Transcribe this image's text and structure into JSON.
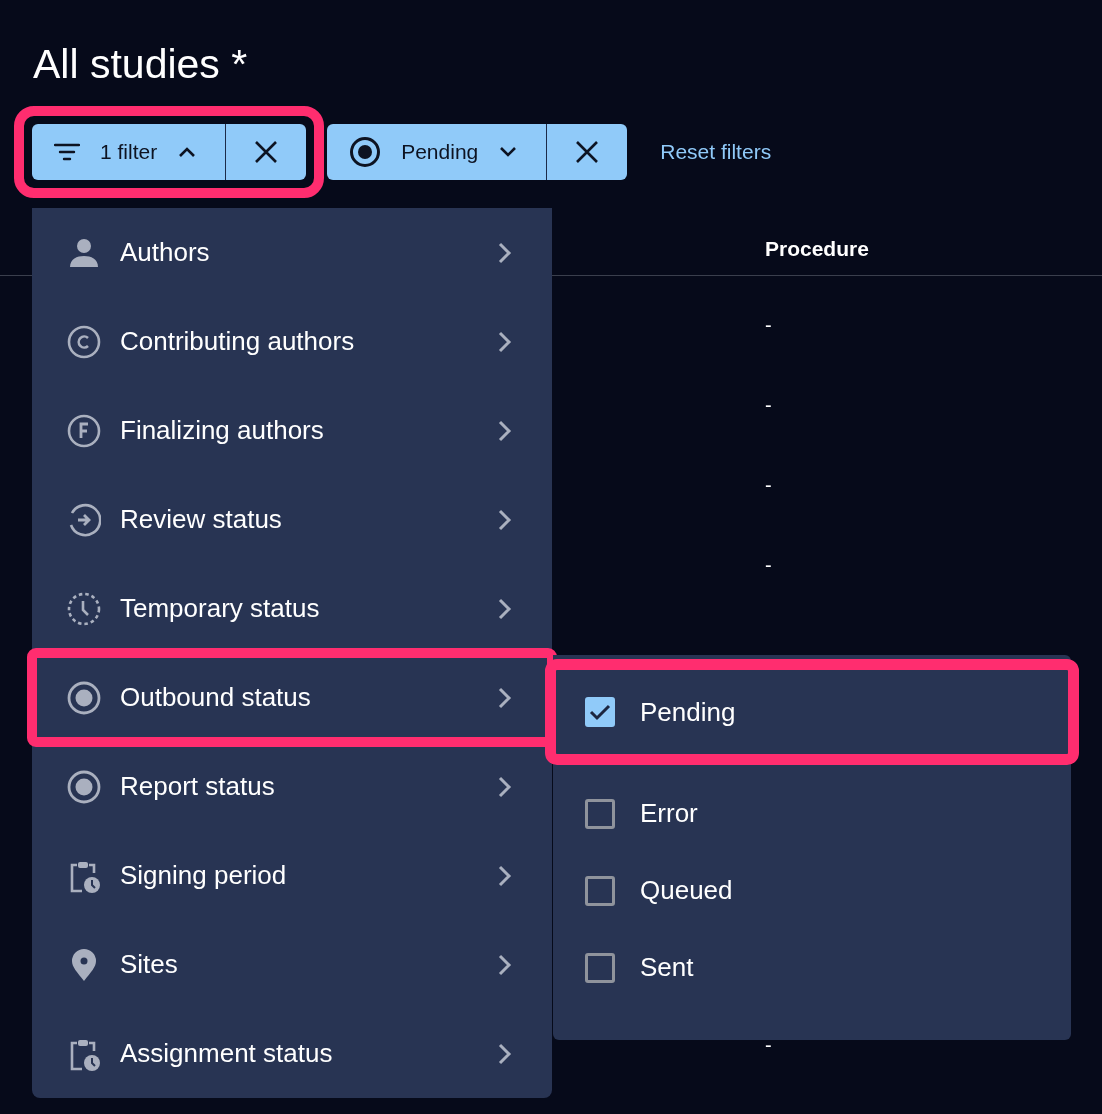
{
  "page": {
    "title": "All studies *"
  },
  "filter_bar": {
    "filter_button": {
      "label": "1 filter",
      "expanded": true,
      "highlighted": true
    },
    "chips": [
      {
        "label": "Pending",
        "expanded": false
      }
    ],
    "reset_link": "Reset filters"
  },
  "table": {
    "columns": [
      "Procedure"
    ],
    "rows": [
      {
        "procedure": "-"
      },
      {
        "procedure": "-"
      },
      {
        "procedure": "-"
      },
      {
        "procedure": "-"
      },
      {
        "procedure": "-"
      }
    ]
  },
  "filter_menu": {
    "items": [
      {
        "label": "Authors",
        "highlighted": false
      },
      {
        "label": "Contributing authors",
        "highlighted": false
      },
      {
        "label": "Finalizing authors",
        "highlighted": false
      },
      {
        "label": "Review status",
        "highlighted": false
      },
      {
        "label": "Temporary status",
        "highlighted": false
      },
      {
        "label": "Outbound status",
        "highlighted": true
      },
      {
        "label": "Report status",
        "highlighted": false
      },
      {
        "label": "Signing period",
        "highlighted": false
      },
      {
        "label": "Sites",
        "highlighted": false
      },
      {
        "label": "Assignment status",
        "highlighted": false
      }
    ]
  },
  "submenu": {
    "options": [
      {
        "label": "Pending",
        "checked": true,
        "highlighted": true
      },
      {
        "label": "Error",
        "checked": false,
        "highlighted": false
      },
      {
        "label": "Queued",
        "checked": false,
        "highlighted": false
      },
      {
        "label": "Sent",
        "checked": false,
        "highlighted": false
      }
    ]
  }
}
